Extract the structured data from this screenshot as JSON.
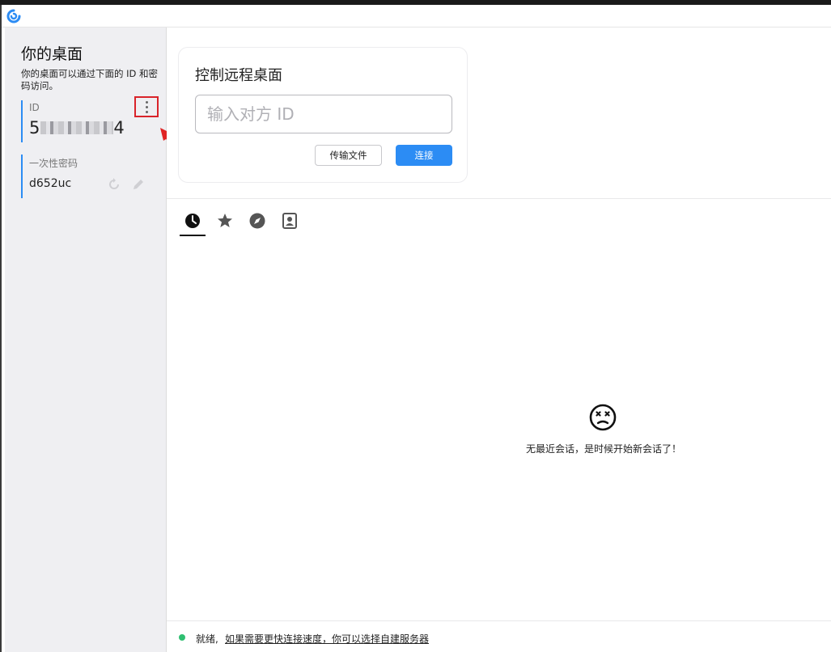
{
  "sidebar": {
    "title": "你的桌面",
    "description": "你的桌面可以通过下面的 ID 和密码访问。",
    "id_label": "ID",
    "id_prefix": "5",
    "id_suffix": "4",
    "password_label": "一次性密码",
    "password_value": "d652uc"
  },
  "connect_card": {
    "title": "控制远程桌面",
    "input_placeholder": "输入对方 ID",
    "transfer_button": "传输文件",
    "connect_button": "连接"
  },
  "tabs": [
    {
      "icon": "clock-icon",
      "active": true
    },
    {
      "icon": "star-icon",
      "active": false
    },
    {
      "icon": "compass-icon",
      "active": false
    },
    {
      "icon": "address-book-icon",
      "active": false
    }
  ],
  "empty_state": {
    "message": "无最近会话，是时候开始新会话了！"
  },
  "status": {
    "state": "就绪,",
    "link": "如果需要更快连接速度，你可以选择自建服务器"
  },
  "colors": {
    "accent": "#2c8cf4",
    "status_ok": "#2fbf71",
    "highlight": "#d9232a",
    "sidebar_bg": "#efeff2"
  }
}
